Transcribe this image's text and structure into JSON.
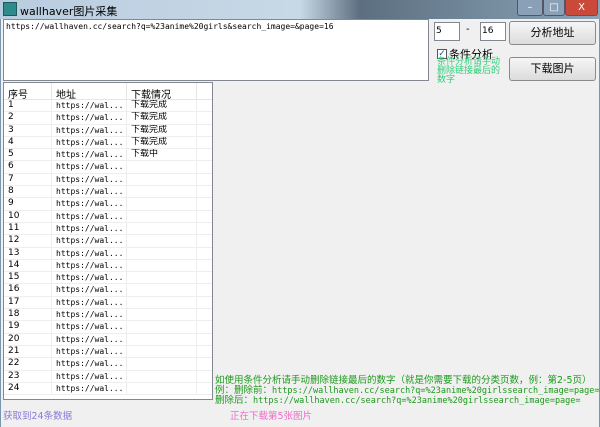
{
  "window": {
    "title": "wallhaver图片采集",
    "minimize": "–",
    "maximize": "□",
    "close": "X"
  },
  "url_input": {
    "value": "https://wallhaven.cc/search?q=%23anime%20girls&search_image=&page=16"
  },
  "range": {
    "start": "5",
    "separator": "-",
    "end": "16"
  },
  "buttons": {
    "analyze": "分析地址",
    "download": "下载图片"
  },
  "condition": {
    "label": "条件分析",
    "checked": true,
    "note": "条件分析请手动删除链接最后的数字"
  },
  "table": {
    "headers": [
      "序号",
      "地址",
      "下载情况"
    ],
    "rows": [
      [
        "1",
        "https://wal...",
        "下载完成"
      ],
      [
        "2",
        "https://wal...",
        "下载完成"
      ],
      [
        "3",
        "https://wal...",
        "下载完成"
      ],
      [
        "4",
        "https://wal...",
        "下载完成"
      ],
      [
        "5",
        "https://wal...",
        "下载中"
      ],
      [
        "6",
        "https://wal...",
        ""
      ],
      [
        "7",
        "https://wal...",
        ""
      ],
      [
        "8",
        "https://wal...",
        ""
      ],
      [
        "9",
        "https://wal...",
        ""
      ],
      [
        "10",
        "https://wal...",
        ""
      ],
      [
        "11",
        "https://wal...",
        ""
      ],
      [
        "12",
        "https://wal...",
        ""
      ],
      [
        "13",
        "https://wal...",
        ""
      ],
      [
        "14",
        "https://wal...",
        ""
      ],
      [
        "15",
        "https://wal...",
        ""
      ],
      [
        "16",
        "https://wal...",
        ""
      ],
      [
        "17",
        "https://wal...",
        ""
      ],
      [
        "18",
        "https://wal...",
        ""
      ],
      [
        "19",
        "https://wal...",
        ""
      ],
      [
        "20",
        "https://wal...",
        ""
      ],
      [
        "21",
        "https://wal...",
        ""
      ],
      [
        "22",
        "https://wal...",
        ""
      ],
      [
        "23",
        "https://wal...",
        ""
      ],
      [
        "24",
        "https://wal...",
        ""
      ]
    ]
  },
  "help": {
    "line1": "如使用条件分析请手动删除链接最后的数字（就是你需要下载的分类页数，例：第2-5页）",
    "line2_label": "例：删除前：",
    "line2_url": "https://wallhaven.cc/search?q=%23anime%20girlssearch_image=page=2",
    "line3_label": "删除后：",
    "line3_url": "https://wallhaven.cc/search?q=%23anime%20girlssearch_image=page="
  },
  "status": {
    "count": "获取到24条数据",
    "progress": "正在下载第5张图片"
  },
  "colors": {
    "note": "#2ed07a",
    "help": "#1c9a1c",
    "count": "#8a7ad8",
    "progress": "#f06ac8"
  }
}
